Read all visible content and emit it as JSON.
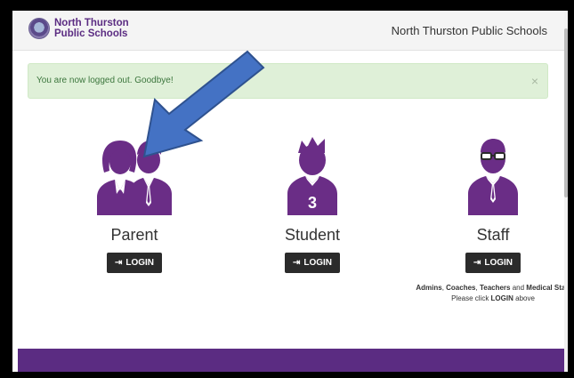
{
  "navbar": {
    "brand_line1": "North Thurston",
    "brand_line2": "Public Schools",
    "title": "North Thurston Public Schools"
  },
  "alert": {
    "message": "You are now logged out. Goodbye!",
    "close": "×"
  },
  "roles": [
    {
      "label": "Parent",
      "button": "LOGIN",
      "jersey_number": ""
    },
    {
      "label": "Student",
      "button": "LOGIN",
      "jersey_number": "3"
    },
    {
      "label": "Staff",
      "button": "LOGIN",
      "jersey_number": ""
    }
  ],
  "staff_note": {
    "line1_b1": "Admins",
    "line1_t1": ", ",
    "line1_b2": "Coaches",
    "line1_t2": ", ",
    "line1_b3": "Teachers",
    "line1_t3": " and ",
    "line1_b4": "Medical Staff",
    "line2_t1": "Please click ",
    "line2_b1": "LOGIN",
    "line2_t2": " above"
  },
  "icons": {
    "login": "login-arrow-icon",
    "parent": "parents-icon",
    "student": "student-icon",
    "staff": "staff-icon"
  },
  "colors": {
    "brand_purple": "#5b2c82",
    "icon_purple": "#6a2d86",
    "alert_bg": "#dff0d8",
    "alert_text": "#3c763d",
    "button_bg": "#2b2b2b",
    "annotation_arrow": "#4472c4"
  }
}
